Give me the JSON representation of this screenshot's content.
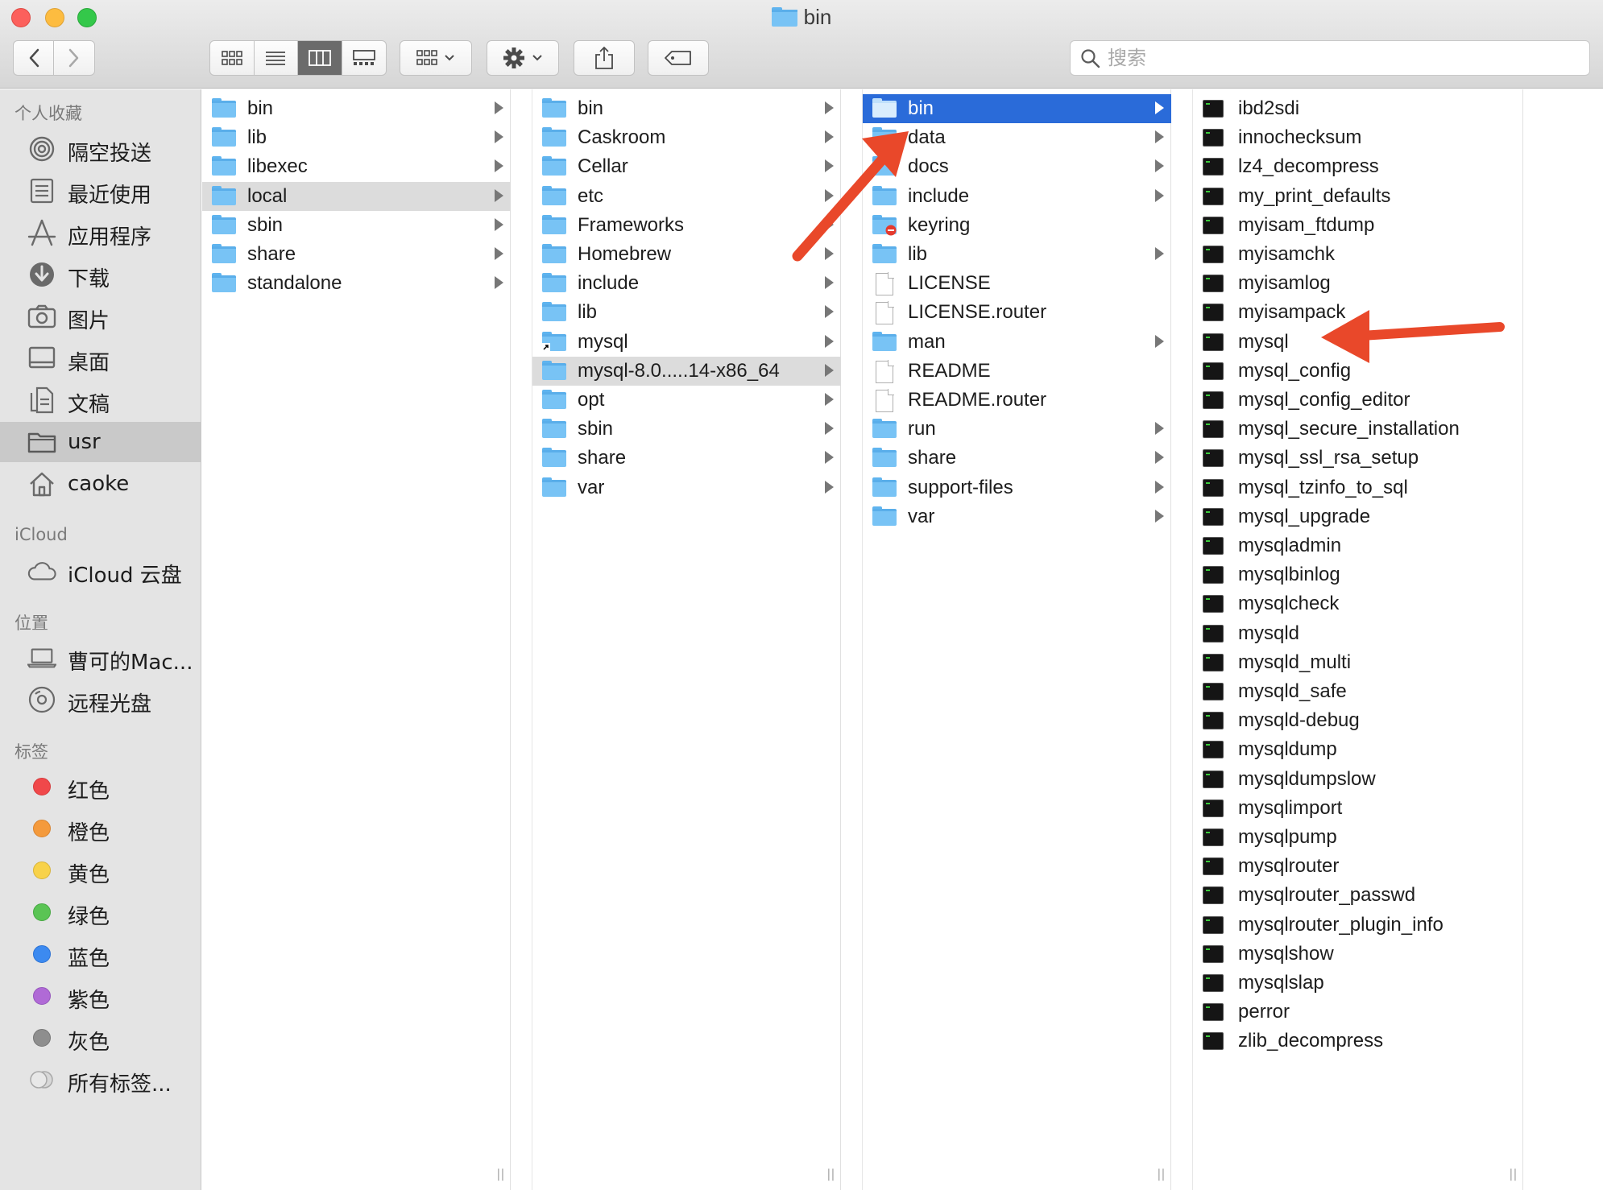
{
  "window": {
    "title": "bin"
  },
  "toolbar": {
    "back_label": "‹",
    "forward_label": "›",
    "search_placeholder": "搜索"
  },
  "sidebar": {
    "favorites_header": "个人收藏",
    "favorites": [
      {
        "label": "隔空投送",
        "icon": "airdrop-icon"
      },
      {
        "label": "最近使用",
        "icon": "recents-icon"
      },
      {
        "label": "应用程序",
        "icon": "applications-icon"
      },
      {
        "label": "下载",
        "icon": "downloads-icon"
      },
      {
        "label": "图片",
        "icon": "pictures-icon"
      },
      {
        "label": "桌面",
        "icon": "desktop-icon"
      },
      {
        "label": "文稿",
        "icon": "documents-icon"
      },
      {
        "label": "usr",
        "icon": "folder-icon",
        "selected": true
      },
      {
        "label": "caoke",
        "icon": "home-icon"
      }
    ],
    "icloud_header": "iCloud",
    "icloud": [
      {
        "label": "iCloud 云盘",
        "icon": "cloud-icon"
      }
    ],
    "locations_header": "位置",
    "locations": [
      {
        "label": "曹可的Mac...",
        "icon": "laptop-icon"
      },
      {
        "label": "远程光盘",
        "icon": "disc-icon"
      }
    ],
    "tags_header": "标签",
    "tags": [
      {
        "label": "红色",
        "color": "#f0484a"
      },
      {
        "label": "橙色",
        "color": "#f49a3c"
      },
      {
        "label": "黄色",
        "color": "#f8d24a"
      },
      {
        "label": "绿色",
        "color": "#5ac454"
      },
      {
        "label": "蓝色",
        "color": "#3c8af0"
      },
      {
        "label": "紫色",
        "color": "#b06ad6"
      },
      {
        "label": "灰色",
        "color": "#8e8e8e"
      },
      {
        "label": "所有标签...",
        "color": "#d0d0d0"
      }
    ]
  },
  "columns": [
    {
      "items": [
        {
          "label": "bin",
          "type": "folder",
          "arrow": true
        },
        {
          "label": "lib",
          "type": "folder",
          "arrow": true
        },
        {
          "label": "libexec",
          "type": "folder",
          "arrow": true
        },
        {
          "label": "local",
          "type": "folder",
          "arrow": true,
          "state": "gray"
        },
        {
          "label": "sbin",
          "type": "folder",
          "arrow": true
        },
        {
          "label": "share",
          "type": "folder",
          "arrow": true
        },
        {
          "label": "standalone",
          "type": "folder",
          "arrow": true
        }
      ]
    },
    {
      "items": [
        {
          "label": "bin",
          "type": "folder",
          "arrow": true
        },
        {
          "label": "Caskroom",
          "type": "folder",
          "arrow": true
        },
        {
          "label": "Cellar",
          "type": "folder",
          "arrow": true
        },
        {
          "label": "etc",
          "type": "folder",
          "arrow": true
        },
        {
          "label": "Frameworks",
          "type": "folder",
          "arrow": true
        },
        {
          "label": "Homebrew",
          "type": "folder",
          "arrow": true
        },
        {
          "label": "include",
          "type": "folder",
          "arrow": true
        },
        {
          "label": "lib",
          "type": "folder",
          "arrow": true
        },
        {
          "label": "mysql",
          "type": "alias-folder",
          "arrow": true
        },
        {
          "label": "mysql-8.0.....14-x86_64",
          "type": "folder",
          "arrow": true,
          "state": "gray"
        },
        {
          "label": "opt",
          "type": "folder",
          "arrow": true
        },
        {
          "label": "sbin",
          "type": "folder",
          "arrow": true
        },
        {
          "label": "share",
          "type": "folder",
          "arrow": true
        },
        {
          "label": "var",
          "type": "folder",
          "arrow": true
        }
      ]
    },
    {
      "items": [
        {
          "label": "bin",
          "type": "folder",
          "arrow": true,
          "state": "blue"
        },
        {
          "label": "data",
          "type": "folder",
          "arrow": true
        },
        {
          "label": "docs",
          "type": "folder",
          "arrow": true
        },
        {
          "label": "include",
          "type": "folder",
          "arrow": true
        },
        {
          "label": "keyring",
          "type": "locked-folder",
          "arrow": false
        },
        {
          "label": "lib",
          "type": "folder",
          "arrow": true
        },
        {
          "label": "LICENSE",
          "type": "doc",
          "arrow": false
        },
        {
          "label": "LICENSE.router",
          "type": "doc",
          "arrow": false
        },
        {
          "label": "man",
          "type": "folder",
          "arrow": true
        },
        {
          "label": "README",
          "type": "doc",
          "arrow": false
        },
        {
          "label": "README.router",
          "type": "doc",
          "arrow": false
        },
        {
          "label": "run",
          "type": "folder",
          "arrow": true
        },
        {
          "label": "share",
          "type": "folder",
          "arrow": true
        },
        {
          "label": "support-files",
          "type": "folder",
          "arrow": true
        },
        {
          "label": "var",
          "type": "folder",
          "arrow": true
        }
      ]
    },
    {
      "items": [
        {
          "label": "ibd2sdi",
          "type": "exec"
        },
        {
          "label": "innochecksum",
          "type": "exec"
        },
        {
          "label": "lz4_decompress",
          "type": "exec"
        },
        {
          "label": "my_print_defaults",
          "type": "exec"
        },
        {
          "label": "myisam_ftdump",
          "type": "exec"
        },
        {
          "label": "myisamchk",
          "type": "exec"
        },
        {
          "label": "myisamlog",
          "type": "exec"
        },
        {
          "label": "myisampack",
          "type": "exec"
        },
        {
          "label": "mysql",
          "type": "exec"
        },
        {
          "label": "mysql_config",
          "type": "exec"
        },
        {
          "label": "mysql_config_editor",
          "type": "exec"
        },
        {
          "label": "mysql_secure_installation",
          "type": "exec"
        },
        {
          "label": "mysql_ssl_rsa_setup",
          "type": "exec"
        },
        {
          "label": "mysql_tzinfo_to_sql",
          "type": "exec"
        },
        {
          "label": "mysql_upgrade",
          "type": "exec"
        },
        {
          "label": "mysqladmin",
          "type": "exec"
        },
        {
          "label": "mysqlbinlog",
          "type": "exec"
        },
        {
          "label": "mysqlcheck",
          "type": "exec"
        },
        {
          "label": "mysqld",
          "type": "exec"
        },
        {
          "label": "mysqld_multi",
          "type": "exec"
        },
        {
          "label": "mysqld_safe",
          "type": "exec"
        },
        {
          "label": "mysqld-debug",
          "type": "exec"
        },
        {
          "label": "mysqldump",
          "type": "exec"
        },
        {
          "label": "mysqldumpslow",
          "type": "exec"
        },
        {
          "label": "mysqlimport",
          "type": "exec"
        },
        {
          "label": "mysqlpump",
          "type": "exec"
        },
        {
          "label": "mysqlrouter",
          "type": "exec"
        },
        {
          "label": "mysqlrouter_passwd",
          "type": "exec"
        },
        {
          "label": "mysqlrouter_plugin_info",
          "type": "exec"
        },
        {
          "label": "mysqlshow",
          "type": "exec"
        },
        {
          "label": "mysqlslap",
          "type": "exec"
        },
        {
          "label": "perror",
          "type": "exec"
        },
        {
          "label": "zlib_decompress",
          "type": "exec"
        }
      ]
    }
  ],
  "colors": {
    "selection_blue": "#2a6bd9",
    "annotation_arrow": "#e9482a",
    "folder_blue": "#78c3f5"
  }
}
